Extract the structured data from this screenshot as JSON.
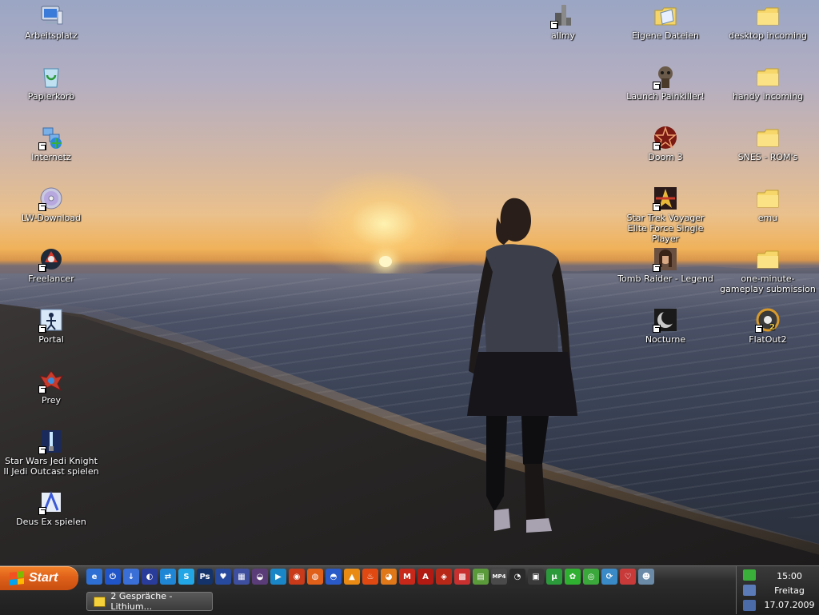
{
  "desktop": {
    "icons_left": [
      {
        "label": "Arbeitsplatz",
        "icon": "computer-icon"
      },
      {
        "label": "Papierkorb",
        "icon": "recycle-bin-icon"
      },
      {
        "label": "Internetz",
        "icon": "network-icon"
      },
      {
        "label": "LW-Download",
        "icon": "cd-icon"
      },
      {
        "label": "Freelancer",
        "icon": "freelancer-icon"
      },
      {
        "label": "Portal",
        "icon": "portal-icon"
      },
      {
        "label": "Prey",
        "icon": "prey-icon"
      },
      {
        "label": "Star Wars Jedi Knight II Jedi Outcast spielen",
        "icon": "jedi-knight-icon"
      },
      {
        "label": "Deus Ex spielen",
        "icon": "deus-ex-icon"
      }
    ],
    "icons_right": [
      {
        "label": "allmy",
        "icon": "allmy-icon"
      },
      {
        "label": "Eigene Dateien",
        "icon": "my-documents-icon"
      },
      {
        "label": "desktop incoming",
        "icon": "folder-icon"
      },
      {
        "label": "Launch Painkiller!",
        "icon": "painkiller-icon"
      },
      {
        "label": "handy incoming",
        "icon": "folder-icon"
      },
      {
        "label": "Doom 3",
        "icon": "doom3-icon"
      },
      {
        "label": "SNES - ROM's",
        "icon": "folder-icon"
      },
      {
        "label": "Star Trek Voyager Elite Force Single Player",
        "icon": "star-trek-icon"
      },
      {
        "label": "emu",
        "icon": "folder-icon"
      },
      {
        "label": "Tomb Raider - Legend",
        "icon": "tomb-raider-icon"
      },
      {
        "label": "one-minute-gameplay submission",
        "icon": "folder-icon"
      },
      {
        "label": "Nocturne",
        "icon": "nocturne-icon"
      },
      {
        "label": "FlatOut2",
        "icon": "flatout2-icon"
      }
    ]
  },
  "taskbar": {
    "start_label": "Start",
    "quick_launch": [
      {
        "icon": "ie-icon",
        "color": "#2d6fd2",
        "glyph": "e"
      },
      {
        "icon": "power-icon",
        "color": "#1f55c8",
        "glyph": "⏻"
      },
      {
        "icon": "download-icon",
        "color": "#3a6fd8",
        "glyph": "↓"
      },
      {
        "icon": "globe-icon",
        "color": "#2a3c9a",
        "glyph": "◐"
      },
      {
        "icon": "teamviewer-icon",
        "color": "#1f86d6",
        "glyph": "⇄"
      },
      {
        "icon": "skype-icon",
        "color": "#22a6e6",
        "glyph": "S"
      },
      {
        "icon": "photoshop-icon",
        "color": "#13336a",
        "glyph": "Ps"
      },
      {
        "icon": "heart-icon",
        "color": "#284a9e",
        "glyph": "♥"
      },
      {
        "icon": "image-icon",
        "color": "#3e4fa0",
        "glyph": "▦"
      },
      {
        "icon": "sunset-icon",
        "color": "#5a3c78",
        "glyph": "◒"
      },
      {
        "icon": "media-player-icon",
        "color": "#1a86c8",
        "glyph": "▶"
      },
      {
        "icon": "winamp-icon",
        "color": "#c83a1a",
        "glyph": "◉"
      },
      {
        "icon": "firefox-icon",
        "color": "#e0601a",
        "glyph": "◍"
      },
      {
        "icon": "opera-icon",
        "color": "#2a5ac8",
        "glyph": "◓"
      },
      {
        "icon": "vlc-icon",
        "color": "#e88a14",
        "glyph": "▲"
      },
      {
        "icon": "flame-icon",
        "color": "#e04a12",
        "glyph": "♨"
      },
      {
        "icon": "blender-icon",
        "color": "#e0781a",
        "glyph": "◕"
      },
      {
        "icon": "gmail-icon",
        "color": "#c8281a",
        "glyph": "M"
      },
      {
        "icon": "acrobat-icon",
        "color": "#b01a12",
        "glyph": "A"
      },
      {
        "icon": "media-icon",
        "color": "#b82818",
        "glyph": "◈"
      },
      {
        "icon": "grid-icon",
        "color": "#c83030",
        "glyph": "▩"
      },
      {
        "icon": "notepad-icon",
        "color": "#5a9a3a",
        "glyph": "▤"
      },
      {
        "icon": "mp4-avi-icon",
        "color": "#4a4a4a",
        "glyph": "MP4"
      },
      {
        "icon": "steam-icon",
        "color": "#2a2a2a",
        "glyph": "◔"
      },
      {
        "icon": "system-icon",
        "color": "#3a3a3a",
        "glyph": "▣"
      },
      {
        "icon": "utorrent-icon",
        "color": "#2a9a3a",
        "glyph": "μ"
      },
      {
        "icon": "icq-icon",
        "color": "#30b030",
        "glyph": "✿"
      },
      {
        "icon": "recorder-icon",
        "color": "#3aa83a",
        "glyph": "◎"
      },
      {
        "icon": "sync-icon",
        "color": "#3a8ac8",
        "glyph": "⟳"
      },
      {
        "icon": "heart-map-icon",
        "color": "#c83a3a",
        "glyph": "♡"
      },
      {
        "icon": "user-icon",
        "color": "#6a8aa8",
        "glyph": "☻"
      }
    ],
    "tasks": [
      {
        "label": "2 Gespräche - Lithium...",
        "icon": "chat-window-icon"
      }
    ],
    "tray": {
      "time": "15:00",
      "day": "Freitag",
      "date": "17.07.2009",
      "icons": [
        {
          "icon": "icq-tray-icon",
          "color": "#3ab03a"
        },
        {
          "icon": "network-tray-icon",
          "color": "#5a7ab8"
        },
        {
          "icon": "monitor-tray-icon",
          "color": "#4a6aa8"
        }
      ]
    }
  }
}
